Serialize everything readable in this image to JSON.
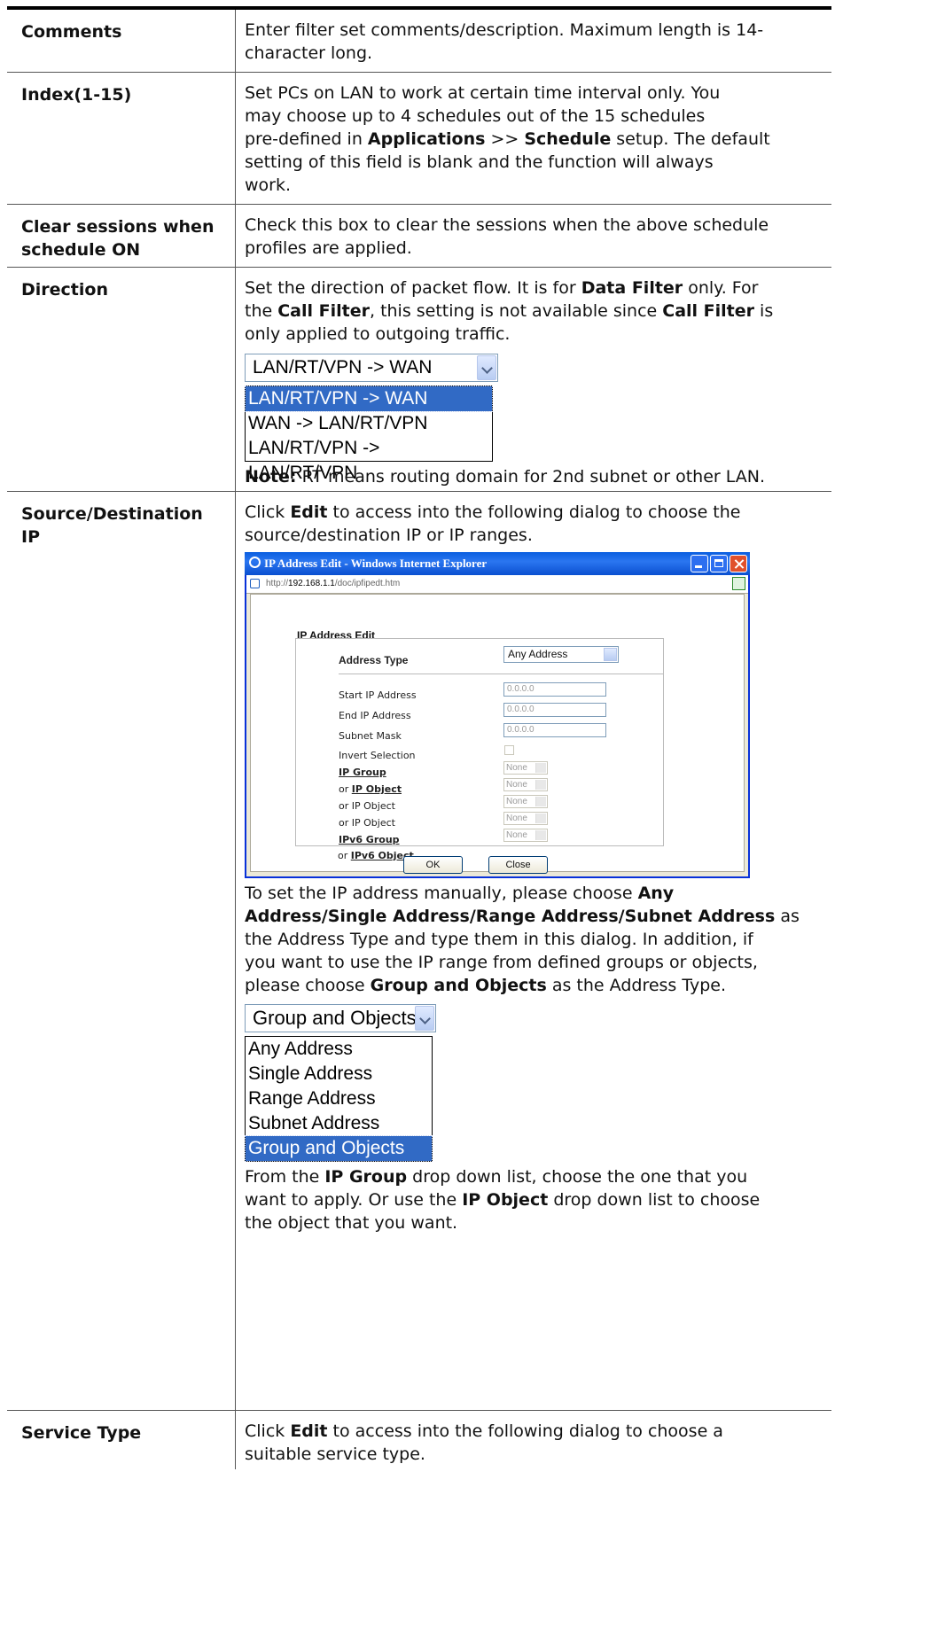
{
  "rows": {
    "comments": {
      "label": "Comments",
      "line1": "Enter filter set comments/description. Maximum length is 14-",
      "line2": "character long."
    },
    "index": {
      "label": "Index(1-15)",
      "l1": "Set PCs on LAN to work at certain time interval only. You",
      "l2": "may choose up to 4 schedules out of the 15 schedules",
      "l3a": "pre-defined in ",
      "l3b": "Applications",
      "l3c": " >> ",
      "l3d": "Schedule",
      "l3e": " setup. The default",
      "l4": "setting of this field is blank and the function will always",
      "l5": "work."
    },
    "clear": {
      "label1": "Clear sessions when",
      "label2": "schedule ON",
      "l1": "Check this box to clear the sessions when the above schedule",
      "l2": "profiles are applied."
    },
    "direction": {
      "label": "Direction",
      "l1a": "Set the direction of packet flow. It is for ",
      "l1b": "Data Filter",
      "l1c": " only. For",
      "l2a": "the ",
      "l2b": "Call Filter",
      "l2c": ", this setting is not available since ",
      "l2d": "Call Filter",
      "l2e": " is",
      "l3": "only applied to outgoing traffic.",
      "select_value": "LAN/RT/VPN -> WAN",
      "options": [
        "LAN/RT/VPN -> WAN",
        "WAN -> LAN/RT/VPN",
        "LAN/RT/VPN -> LAN/RT/VPN"
      ],
      "note_label": "Note:",
      "note_text": " RT means routing domain for 2nd subnet or other LAN."
    },
    "src_dst": {
      "label": "Source/Destination IP",
      "l1a": "Click ",
      "l1b": "Edit",
      "l1c": " to access into the following dialog to choose the",
      "l2": "source/destination IP or IP ranges.",
      "p2_l1a": "To set the IP address manually, please choose ",
      "p2_l1b": "Any",
      "p2_l2b": "Address/Single Address/Range Address/Subnet Address",
      "p2_l2c": " as",
      "p2_l3": "the Address Type and type them in this dialog. In addition, if",
      "p2_l4": "you want to use the IP range from defined groups or objects,",
      "p2_l5a": "please choose ",
      "p2_l5b": "Group and Objects",
      "p2_l5c": " as the Address Type.",
      "addr_select_value": "Group and Objects",
      "addr_options": [
        "Any Address",
        "Single Address",
        "Range Address",
        "Subnet Address",
        "Group and Objects"
      ],
      "p3_l1a": "From the ",
      "p3_l1b": "IP Group",
      "p3_l1c": " drop down list, choose the one that you",
      "p3_l2a": "want to apply. Or use the ",
      "p3_l2b": "IP Object",
      "p3_l2c": " drop down list to choose",
      "p3_l3": "the object that you want."
    },
    "service": {
      "label": "Service Type",
      "l1a": "Click ",
      "l1b": "Edit",
      "l1c": " to access into the following dialog to choose a",
      "l2": "suitable service type."
    }
  },
  "dialog": {
    "title": "IP Address Edit - Windows Internet Explorer",
    "url_prefix": "http://",
    "url_host": "192.168.1.1",
    "url_path": "/doc/ipfipedt.htm",
    "form_title": "IP Address Edit",
    "address_type_label": "Address Type",
    "address_type_value": "Any Address",
    "start_ip_label": "Start IP Address",
    "start_ip_value": "0.0.0.0",
    "end_ip_label": "End IP Address",
    "end_ip_value": "0.0.0.0",
    "subnet_label": "Subnet Mask",
    "subnet_value": "0.0.0.0",
    "invert_label": "Invert Selection",
    "ip_group_label": "IP Group",
    "or": "or ",
    "ip_object_link": "IP Object",
    "ip_object_label": "or IP Object",
    "ipv6_group_label": "IPv6 Group",
    "ipv6_object_link": "IPv6 Object",
    "ipv6_object_label": "or IPv6 Object",
    "none": "None",
    "ok": "OK",
    "close": "Close"
  }
}
